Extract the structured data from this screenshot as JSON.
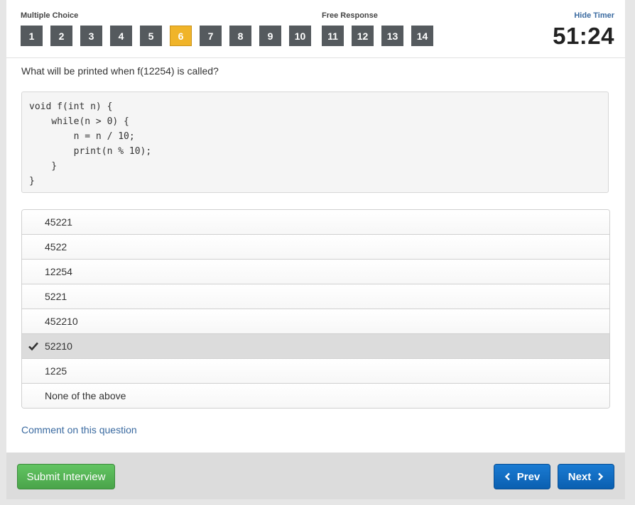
{
  "header": {
    "multiple_choice_label": "Multiple Choice",
    "free_response_label": "Free Response",
    "hide_timer_label": "Hide Timer",
    "timer": "51:24",
    "questions": [
      "1",
      "2",
      "3",
      "4",
      "5",
      "6",
      "7",
      "8",
      "9",
      "10",
      "11",
      "12",
      "13",
      "14"
    ],
    "active_question": "6"
  },
  "question": {
    "prompt": "What will be printed when f(12254) is called?",
    "code": "void f(int n) {\n    while(n > 0) {\n        n = n / 10;\n        print(n % 10);\n    }\n}"
  },
  "options": [
    "45221",
    "4522",
    "12254",
    "5221",
    "452210",
    "52210",
    "1225",
    "None of the above"
  ],
  "selected_option": "52210",
  "comment_link": "Comment on this question",
  "footer": {
    "submit_label": "Submit Interview",
    "prev_label": "Prev",
    "next_label": "Next"
  },
  "colors": {
    "active_question": "#f0b429",
    "question_button": "#555a5e",
    "primary": "#0a66c2",
    "success": "#5cb85c",
    "link": "#3a6aa0"
  }
}
